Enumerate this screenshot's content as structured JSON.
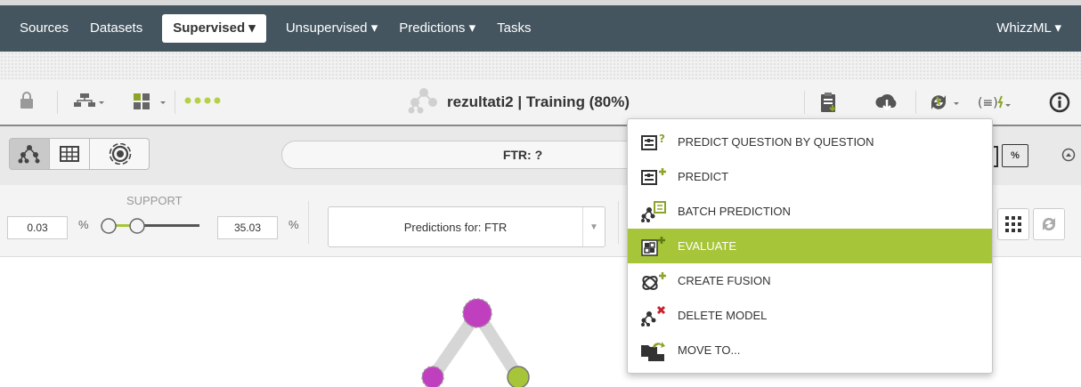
{
  "nav": {
    "items": [
      {
        "label": "Sources"
      },
      {
        "label": "Datasets"
      },
      {
        "label": "Supervised ▾"
      },
      {
        "label": "Unsupervised ▾"
      },
      {
        "label": "Predictions ▾"
      },
      {
        "label": "Tasks"
      }
    ],
    "right": "WhizzML ▾"
  },
  "toolbar": {
    "title": "rezultati2 | Training (80%)"
  },
  "view": {
    "filter_label": "FTR: ?"
  },
  "controls": {
    "support_label": "SUPPORT",
    "support_min": "0.03",
    "support_max": "35.03",
    "percent": "%",
    "predictions_select": "Predictions for: FTR"
  },
  "menu": {
    "items": [
      {
        "label": "PREDICT QUESTION BY QUESTION",
        "icon": "predict-question-icon"
      },
      {
        "label": "PREDICT",
        "icon": "predict-icon"
      },
      {
        "label": "BATCH PREDICTION",
        "icon": "batch-prediction-icon"
      },
      {
        "label": "EVALUATE",
        "icon": "evaluate-icon"
      },
      {
        "label": "CREATE FUSION",
        "icon": "fusion-icon"
      },
      {
        "label": "DELETE MODEL",
        "icon": "delete-model-icon"
      },
      {
        "label": "MOVE TO...",
        "icon": "move-icon"
      }
    ]
  },
  "colors": {
    "navbar": "#445560",
    "accent": "#a7c539",
    "node_root": "#c03fbf",
    "node_green": "#a7c539"
  }
}
